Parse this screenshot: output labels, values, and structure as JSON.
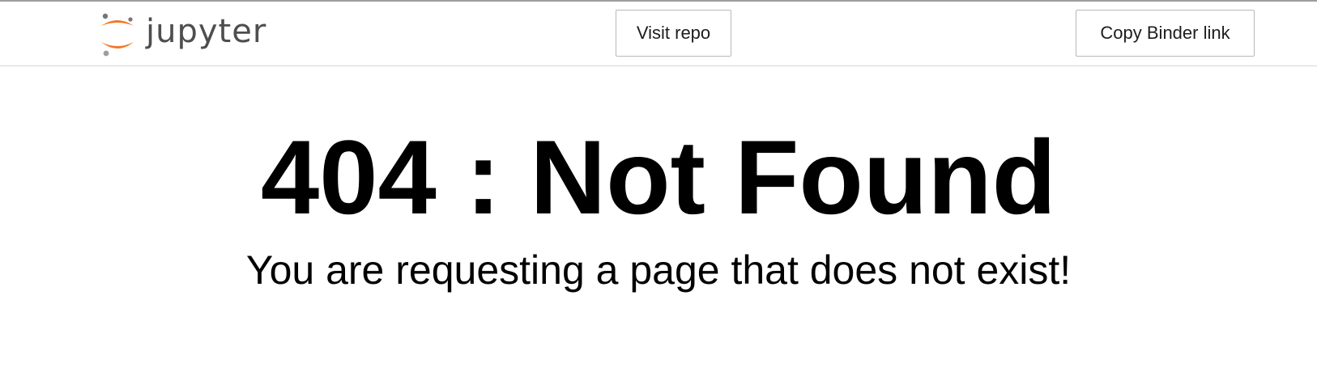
{
  "header": {
    "brand": {
      "logo_text": "jupyter",
      "icon": "jupyter-logo-icon",
      "colors": {
        "orange": "#F37726",
        "gray": "#767677",
        "text": "#4E4E4E"
      }
    },
    "visit_repo_label": "Visit repo",
    "copy_binder_label": "Copy Binder link"
  },
  "main": {
    "title": "404 : Not Found",
    "message": "You are requesting a page that does not exist!"
  }
}
